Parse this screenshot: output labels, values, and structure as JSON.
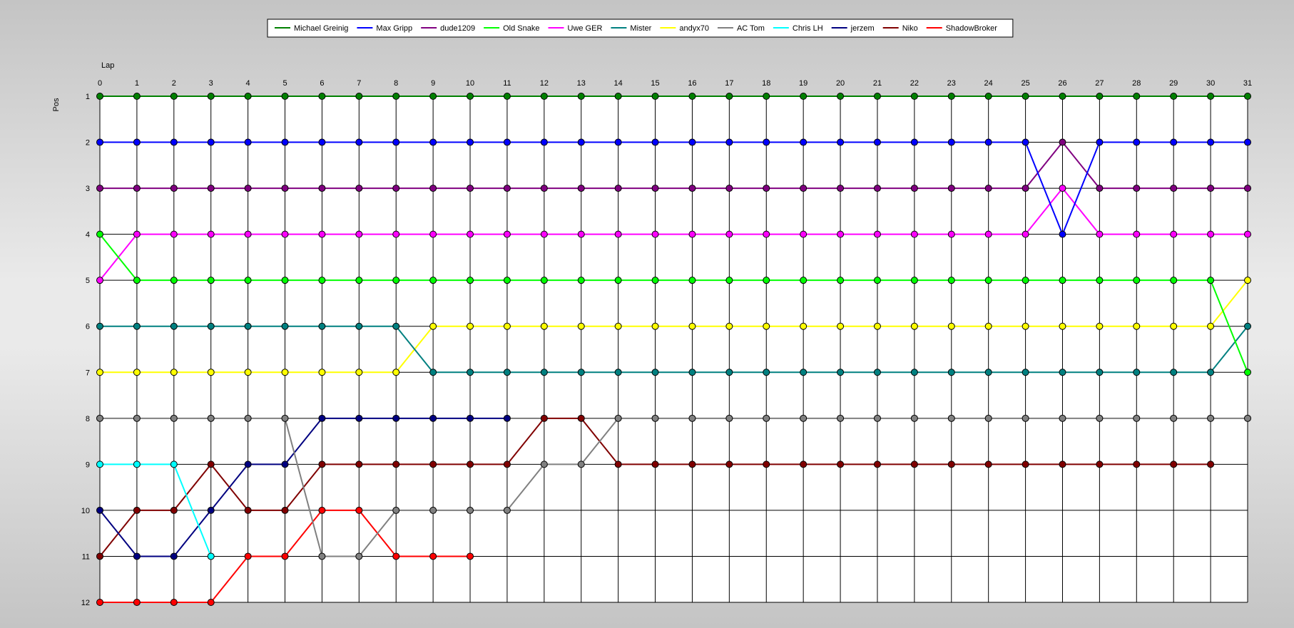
{
  "chart_data": {
    "type": "line",
    "xlabel": "Lap",
    "ylabel": "Pos",
    "xlim": [
      0,
      31
    ],
    "ylim": [
      1,
      12
    ],
    "y_inverted": true,
    "grid": true,
    "legend_position": "top",
    "x": [
      0,
      1,
      2,
      3,
      4,
      5,
      6,
      7,
      8,
      9,
      10,
      11,
      12,
      13,
      14,
      15,
      16,
      17,
      18,
      19,
      20,
      21,
      22,
      23,
      24,
      25,
      26,
      27,
      28,
      29,
      30,
      31
    ],
    "y_ticks": [
      1,
      2,
      3,
      4,
      5,
      6,
      7,
      8,
      9,
      10,
      11,
      12
    ],
    "series": [
      {
        "name": "Michael Greinig",
        "color": "#008000",
        "values": [
          1,
          1,
          1,
          1,
          1,
          1,
          1,
          1,
          1,
          1,
          1,
          1,
          1,
          1,
          1,
          1,
          1,
          1,
          1,
          1,
          1,
          1,
          1,
          1,
          1,
          1,
          1,
          1,
          1,
          1,
          1,
          1
        ]
      },
      {
        "name": "Max Gripp",
        "color": "#0000ff",
        "values": [
          2,
          2,
          2,
          2,
          2,
          2,
          2,
          2,
          2,
          2,
          2,
          2,
          2,
          2,
          2,
          2,
          2,
          2,
          2,
          2,
          2,
          2,
          2,
          2,
          2,
          2,
          4,
          2,
          2,
          2,
          2,
          2
        ]
      },
      {
        "name": "dude1209",
        "color": "#800080",
        "values": [
          3,
          3,
          3,
          3,
          3,
          3,
          3,
          3,
          3,
          3,
          3,
          3,
          3,
          3,
          3,
          3,
          3,
          3,
          3,
          3,
          3,
          3,
          3,
          3,
          3,
          3,
          2,
          3,
          3,
          3,
          3,
          3
        ]
      },
      {
        "name": "Old Snake",
        "color": "#00ff00",
        "values": [
          4,
          5,
          5,
          5,
          5,
          5,
          5,
          5,
          5,
          5,
          5,
          5,
          5,
          5,
          5,
          5,
          5,
          5,
          5,
          5,
          5,
          5,
          5,
          5,
          5,
          5,
          5,
          5,
          5,
          5,
          5,
          7
        ]
      },
      {
        "name": "Uwe GER",
        "color": "#ff00ff",
        "values": [
          5,
          4,
          4,
          4,
          4,
          4,
          4,
          4,
          4,
          4,
          4,
          4,
          4,
          4,
          4,
          4,
          4,
          4,
          4,
          4,
          4,
          4,
          4,
          4,
          4,
          4,
          3,
          4,
          4,
          4,
          4,
          4
        ]
      },
      {
        "name": "Mister",
        "color": "#008080",
        "values": [
          6,
          6,
          6,
          6,
          6,
          6,
          6,
          6,
          6,
          7,
          7,
          7,
          7,
          7,
          7,
          7,
          7,
          7,
          7,
          7,
          7,
          7,
          7,
          7,
          7,
          7,
          7,
          7,
          7,
          7,
          7,
          6
        ]
      },
      {
        "name": "andyx70",
        "color": "#ffff00",
        "values": [
          7,
          7,
          7,
          7,
          7,
          7,
          7,
          7,
          7,
          6,
          6,
          6,
          6,
          6,
          6,
          6,
          6,
          6,
          6,
          6,
          6,
          6,
          6,
          6,
          6,
          6,
          6,
          6,
          6,
          6,
          6,
          5
        ]
      },
      {
        "name": "AC Tom",
        "color": "#808080",
        "values": [
          8,
          8,
          8,
          8,
          8,
          8,
          11,
          11,
          10,
          10,
          10,
          10,
          9,
          9,
          8,
          8,
          8,
          8,
          8,
          8,
          8,
          8,
          8,
          8,
          8,
          8,
          8,
          8,
          8,
          8,
          8,
          8
        ]
      },
      {
        "name": "Chris LH",
        "color": "#00ffff",
        "values": [
          9,
          9,
          9,
          11
        ]
      },
      {
        "name": "jerzem",
        "color": "#000080",
        "values": [
          10,
          11,
          11,
          10,
          9,
          9,
          8,
          8,
          8,
          8,
          8,
          8
        ]
      },
      {
        "name": "Niko",
        "color": "#800000",
        "values": [
          11,
          10,
          10,
          9,
          10,
          10,
          9,
          9,
          9,
          9,
          9,
          9,
          8,
          8,
          9,
          9,
          9,
          9,
          9,
          9,
          9,
          9,
          9,
          9,
          9,
          9,
          9,
          9,
          9,
          9,
          9
        ]
      },
      {
        "name": "ShadowBroker",
        "color": "#ff0000",
        "values": [
          12,
          12,
          12,
          12,
          11,
          11,
          10,
          10,
          11,
          11,
          11
        ]
      }
    ]
  }
}
